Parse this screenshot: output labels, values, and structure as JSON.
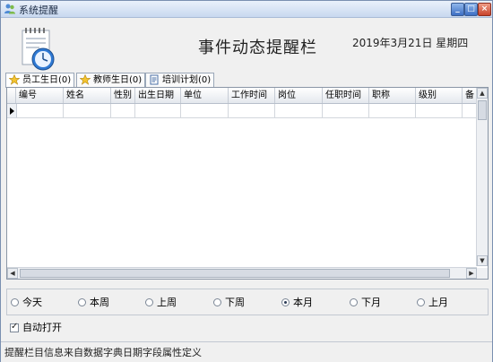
{
  "window": {
    "title": "系统提醒"
  },
  "header": {
    "title": "事件动态提醒栏",
    "date": "2019年3月21日 星期四"
  },
  "tabs": [
    {
      "label": "员工生日(0)"
    },
    {
      "label": "教师生日(0)"
    },
    {
      "label": "培训计划(0)"
    }
  ],
  "grid": {
    "columns": [
      "编号",
      "姓名",
      "性别",
      "出生日期",
      "单位",
      "工作时间",
      "岗位",
      "任职时间",
      "职称",
      "级别",
      "备注"
    ]
  },
  "period": {
    "options": [
      "今天",
      "本周",
      "上周",
      "下周",
      "本月",
      "下月",
      "上月"
    ],
    "selected": "本月"
  },
  "auto_open": {
    "label": "自动打开",
    "checked": true
  },
  "status": {
    "text": "提醒栏目信息来自数据字典日期字段属性定义"
  },
  "colors": {
    "accent": "#3d6fc4",
    "close": "#c8432b"
  }
}
